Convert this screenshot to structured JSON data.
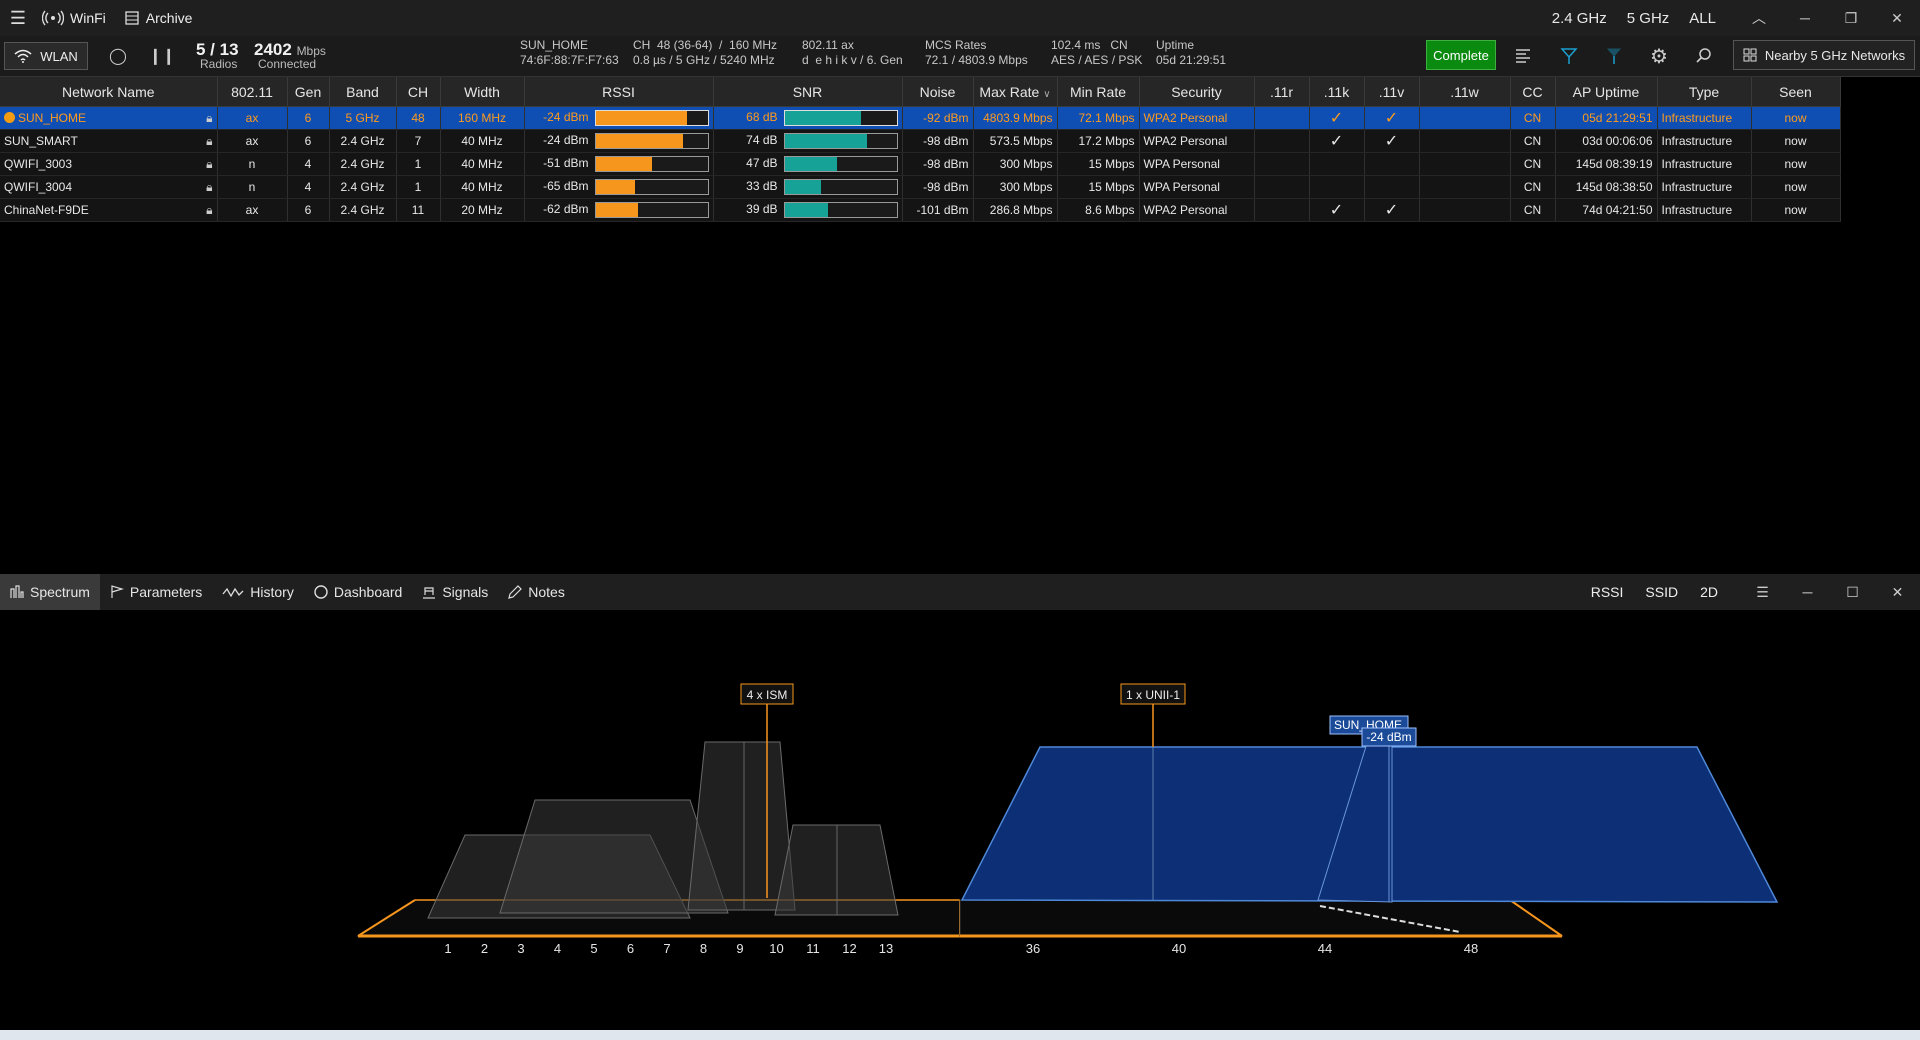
{
  "app": {
    "title": "WinFi",
    "archive_label": "Archive",
    "band_24": "2.4 GHz",
    "band_5": "5 GHz",
    "band_all": "ALL"
  },
  "toolbar": {
    "wlan_label": "WLAN",
    "radios_count": "5 / 13",
    "radios_label": "Radios",
    "rate_value": "2402",
    "rate_unit": "Mbps",
    "rate_label": "Connected",
    "conn_ssid": "SUN_HOME",
    "conn_bssid": "74:6F:88:7F:F7:63",
    "conn_ch": "CH  48 (36-64)  /  160 MHz",
    "conn_gi": "0.8 µs / 5 GHz / 5240 MHz",
    "conn_std": "802.11 ax",
    "conn_gen": "d  e h i k v / 6. Gen",
    "mcs_label": "MCS Rates",
    "mcs_values": "72.1 / 4803.9 Mbps",
    "latency": "102.4 ms   CN",
    "security": "AES / AES / PSK",
    "uptime_label": "Uptime",
    "uptime_value": "05d 21:29:51",
    "complete_label": "Complete",
    "nearby_label": "Nearby 5 GHz Networks"
  },
  "table": {
    "headers": [
      "Network Name",
      "802.11",
      "Gen",
      "Band",
      "CH",
      "Width",
      "RSSI",
      "SNR",
      "Noise",
      "Max Rate",
      "Min Rate",
      "Security",
      ".11r",
      ".11k",
      ".11v",
      ".11w",
      "CC",
      "AP Uptime",
      "Type",
      "Seen"
    ],
    "rows": [
      {
        "name": "SUN_HOME",
        "std": "ax",
        "gen": "6",
        "band": "5 GHz",
        "ch": "48",
        "width": "160 MHz",
        "rssi": "-24 dBm",
        "rssi_pct": 0.82,
        "snr": "68 dB",
        "snr_pct": 0.68,
        "noise": "-92 dBm",
        "max": "4803.9 Mbps",
        "min": "72.1 Mbps",
        "sec": "WPA2 Personal",
        "r": "",
        "k": "✓",
        "v": "✓",
        "w": "",
        "cc": "CN",
        "uptime": "05d 21:29:51",
        "type": "Infrastructure",
        "seen": "now",
        "selected": true,
        "connected": true
      },
      {
        "name": "SUN_SMART",
        "std": "ax",
        "gen": "6",
        "band": "2.4 GHz",
        "ch": "7",
        "width": "40 MHz",
        "rssi": "-24 dBm",
        "rssi_pct": 0.78,
        "snr": "74 dB",
        "snr_pct": 0.74,
        "noise": "-98 dBm",
        "max": "573.5 Mbps",
        "min": "17.2 Mbps",
        "sec": "WPA2 Personal",
        "r": "",
        "k": "✓",
        "v": "✓",
        "w": "",
        "cc": "CN",
        "uptime": "03d 00:06:06",
        "type": "Infrastructure",
        "seen": "now"
      },
      {
        "name": "QWIFI_3003",
        "std": "n",
        "gen": "4",
        "band": "2.4 GHz",
        "ch": "1",
        "width": "40 MHz",
        "rssi": "-51 dBm",
        "rssi_pct": 0.5,
        "snr": "47 dB",
        "snr_pct": 0.47,
        "noise": "-98 dBm",
        "max": "300 Mbps",
        "min": "15 Mbps",
        "sec": "WPA Personal",
        "r": "",
        "k": "",
        "v": "",
        "w": "",
        "cc": "CN",
        "uptime": "145d 08:39:19",
        "type": "Infrastructure",
        "seen": "now"
      },
      {
        "name": "QWIFI_3004",
        "std": "n",
        "gen": "4",
        "band": "2.4 GHz",
        "ch": "1",
        "width": "40 MHz",
        "rssi": "-65 dBm",
        "rssi_pct": 0.35,
        "snr": "33 dB",
        "snr_pct": 0.33,
        "noise": "-98 dBm",
        "max": "300 Mbps",
        "min": "15 Mbps",
        "sec": "WPA Personal",
        "r": "",
        "k": "",
        "v": "",
        "w": "",
        "cc": "CN",
        "uptime": "145d 08:38:50",
        "type": "Infrastructure",
        "seen": "now"
      },
      {
        "name": "ChinaNet-F9DE",
        "std": "ax",
        "gen": "6",
        "band": "2.4 GHz",
        "ch": "11",
        "width": "20 MHz",
        "rssi": "-62 dBm",
        "rssi_pct": 0.38,
        "snr": "39 dB",
        "snr_pct": 0.39,
        "noise": "-101 dBm",
        "max": "286.8 Mbps",
        "min": "8.6 Mbps",
        "sec": "WPA2 Personal",
        "r": "",
        "k": "✓",
        "v": "✓",
        "w": "",
        "cc": "CN",
        "uptime": "74d 04:21:50",
        "type": "Infrastructure",
        "seen": "now"
      }
    ]
  },
  "tabs": {
    "items": [
      {
        "label": "Spectrum",
        "icon": "spectrum-icon",
        "active": true
      },
      {
        "label": "Parameters",
        "icon": "flag-icon"
      },
      {
        "label": "History",
        "icon": "wave-icon"
      },
      {
        "label": "Dashboard",
        "icon": "circle-icon"
      },
      {
        "label": "Signals",
        "icon": "signals-icon"
      },
      {
        "label": "Notes",
        "icon": "pencil-icon"
      }
    ],
    "rssi_label": "RSSI",
    "ssid_label": "SSID",
    "mode_label": "2D"
  },
  "spectrum": {
    "ism_label": "4 x ISM",
    "unii_label": "1 x UNII-1",
    "ap_ssid": "SUN_HOME",
    "ap_rssi": "-24 dBm",
    "channels_24": [
      "1",
      "2",
      "3",
      "4",
      "5",
      "6",
      "7",
      "8",
      "9",
      "10",
      "11",
      "12",
      "13"
    ],
    "channels_5": [
      "36",
      "40",
      "44",
      "48"
    ],
    "colors": {
      "band_outline": "#f7961d",
      "selected_fill": "#0c2f75",
      "selected_edge": "#4f88d8"
    }
  }
}
